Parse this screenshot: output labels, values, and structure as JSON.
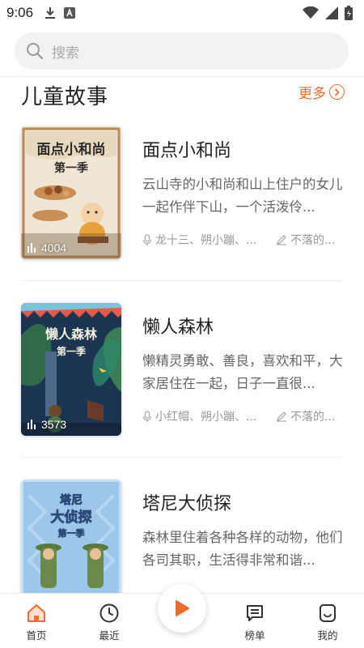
{
  "status_bar": {
    "time": "9:06",
    "icons": [
      "download-icon",
      "a-icon",
      "wifi-icon",
      "signal-icon",
      "battery-icon"
    ]
  },
  "search": {
    "placeholder": "搜索",
    "icon": "search-icon"
  },
  "section": {
    "title": "儿童故事",
    "more_label": "更多"
  },
  "stories": [
    {
      "title": "面点小和尚",
      "description": "云山寺的小和尚和山上住户的女儿一起作伴下山，一个活泼伶...",
      "play_count": "4004",
      "narrator": "龙十三、朔小蹦、...",
      "author": "不落的...",
      "cover_text_1": "面点小和尚",
      "cover_text_2": "第一季"
    },
    {
      "title": "懒人森林",
      "description": "懒精灵勇敢、善良，喜欢和平，大家居住在一起，日子一直很...",
      "play_count": "3573",
      "narrator": "小红帽、朔小蹦、...",
      "author": "不落的...",
      "cover_text_1": "懒人森林",
      "cover_text_2": "第一季"
    },
    {
      "title": "塔尼大侦探",
      "description": "森林里住着各种各样的动物，他们各司其职，生活得非常和谐...",
      "play_count": "",
      "narrator": "",
      "author": "",
      "cover_text_1": "塔尼",
      "cover_text_2": "大侦探",
      "cover_text_3": "第一季"
    }
  ],
  "bottom_nav": {
    "items": [
      {
        "label": "首页",
        "icon": "home-icon",
        "active": true
      },
      {
        "label": "最近",
        "icon": "clock-icon",
        "active": false
      },
      {
        "label": "榜单",
        "icon": "chart-list-icon",
        "active": false
      },
      {
        "label": "我的",
        "icon": "smile-icon",
        "active": false
      }
    ]
  },
  "colors": {
    "accent": "#f26b2b",
    "text": "#222222",
    "muted": "#999999"
  }
}
